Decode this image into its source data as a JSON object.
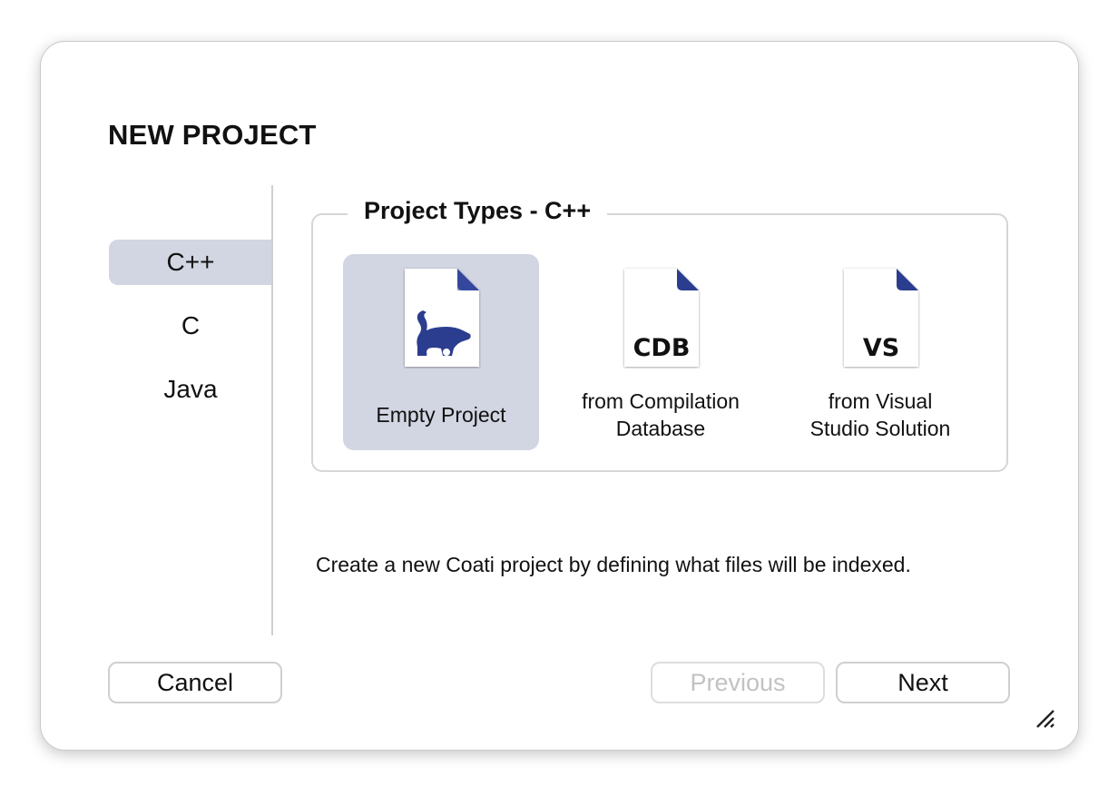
{
  "dialog": {
    "title": "NEW PROJECT"
  },
  "languages": [
    {
      "label": "C++",
      "selected": true
    },
    {
      "label": "C",
      "selected": false
    },
    {
      "label": "Java",
      "selected": false
    }
  ],
  "project_types": {
    "group_title": "Project Types - C++",
    "items": [
      {
        "label": "Empty Project",
        "icon": "coati-doc-icon",
        "selected": true
      },
      {
        "label": "from Compilation\nDatabase",
        "icon_text": "CDB",
        "icon": "cdb-doc-icon",
        "selected": false
      },
      {
        "label": "from Visual\nStudio Solution",
        "icon_text": "VS",
        "icon": "vs-doc-icon",
        "selected": false
      }
    ]
  },
  "description": "Create a new Coati project by defining what files will be indexed.",
  "buttons": {
    "cancel": "Cancel",
    "previous": "Previous",
    "next": "Next"
  },
  "colors": {
    "selection": "#d2d5e2",
    "icon_blue": "#2b3d8f",
    "disabled_text": "#c2c2c2"
  }
}
